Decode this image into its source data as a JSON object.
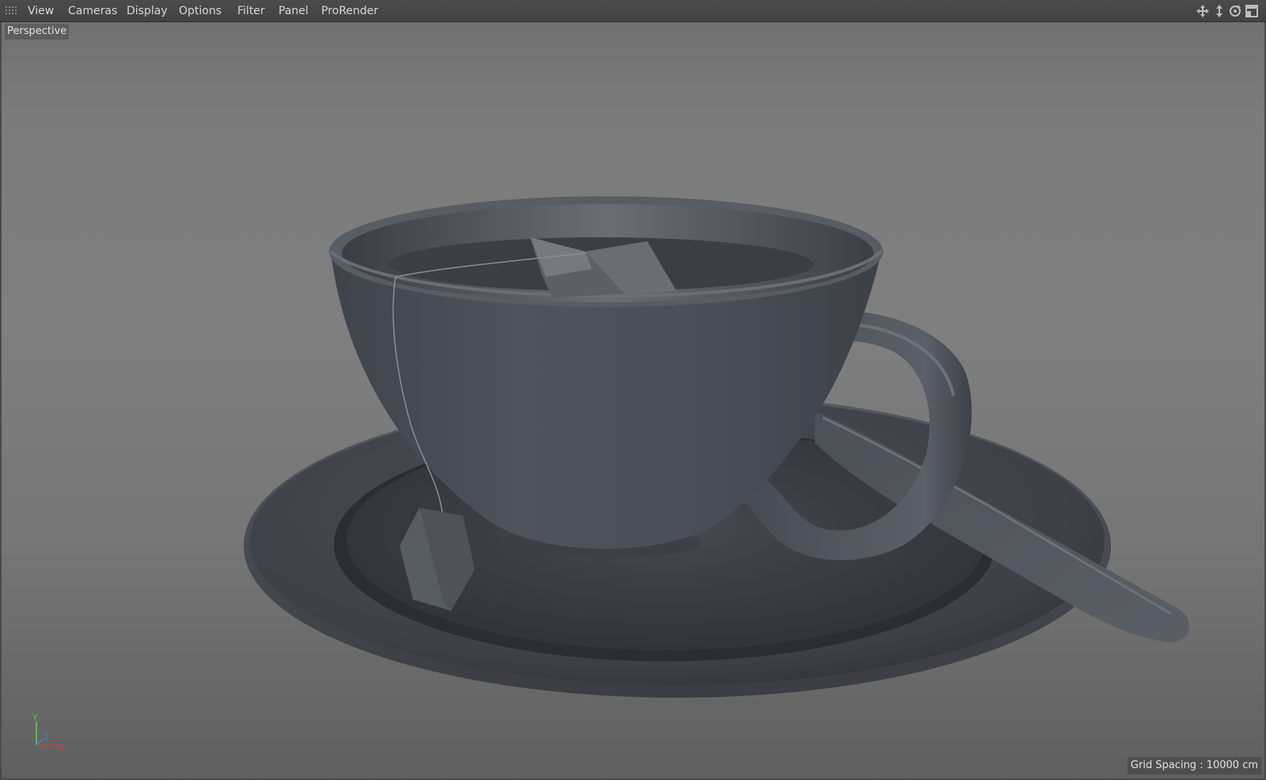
{
  "menubar": {
    "items": [
      "View",
      "Cameras",
      "Display",
      "Options",
      "Filter",
      "Panel",
      "ProRender"
    ]
  },
  "toolbar_icons": [
    "move-icon",
    "zoom-icon",
    "rotate-icon",
    "maximize-icon"
  ],
  "viewport": {
    "camera": "Perspective",
    "grid_spacing": "Grid Spacing : 10000 cm",
    "axes": {
      "y": "Y",
      "z": "Z",
      "x": "X"
    }
  },
  "colors": {
    "menubar": "#464646",
    "menu_text": "#d8d8d8",
    "viewport_bg": "#7b7b7b",
    "model": "#4d5158",
    "axis_x": "#d23a3a",
    "axis_y": "#4fc04f",
    "axis_z": "#4a7bd8"
  }
}
